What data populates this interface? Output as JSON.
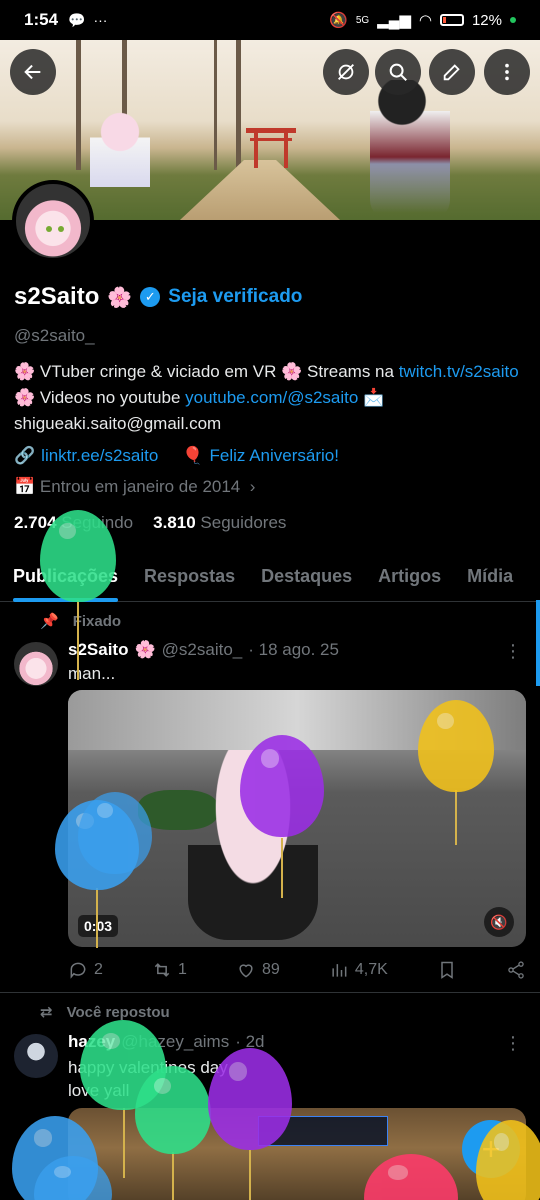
{
  "status_bar": {
    "time": "1:54",
    "network": "5G",
    "battery": "12%"
  },
  "header": {
    "back_icon": "arrow-left-icon",
    "actions": [
      "eye-off-icon",
      "search-icon",
      "pencil-icon",
      "more-vertical-icon"
    ]
  },
  "profile": {
    "name": "s2Saito",
    "name_emoji": "🌸",
    "verify_cta": "Seja verificado",
    "handle": "@s2saito_",
    "bio": {
      "part1": "🌸 VTuber cringe & viciado em VR 🌸 Streams na ",
      "link1": "twitch.tv/s2saito",
      "part2": " 🌸 Videos no youtube ",
      "link2": "youtube.com/@s2saito",
      "part3": " 📩 shigueaki.saito@gmail.com"
    },
    "website": "linktr.ee/s2saito",
    "birthday": "Feliz Aniversário!",
    "joined": "Entrou em janeiro de 2014",
    "following_count": "2.704",
    "following_label": "Seguindo",
    "followers_count": "3.810",
    "followers_label": "Seguidores"
  },
  "tabs": [
    "Publicações",
    "Respostas",
    "Destaques",
    "Artigos",
    "Mídia"
  ],
  "posts": [
    {
      "context": "Fixado",
      "author": "s2Saito",
      "author_emoji": "🌸",
      "handle": "@s2saito_",
      "date": "· 18 ago. 25",
      "text": "man...",
      "video_time": "0:03",
      "replies": "2",
      "reposts": "1",
      "likes": "89",
      "views": "4,7K"
    },
    {
      "context": "Você repostou",
      "author": "hazey",
      "handle": "@hazey_aims",
      "date": "· 2d",
      "text_line1": "happy valentines day",
      "text_line2": "love yall"
    }
  ],
  "colors": {
    "accent": "#1d9bf0",
    "muted": "#71767b",
    "background": "#000000",
    "balloon_green": "#2ee08a",
    "balloon_blue": "#3aa0f0",
    "balloon_yellow": "#f2c21a",
    "balloon_purple": "#9b2ee6",
    "balloon_pink": "#ff3b6b"
  }
}
